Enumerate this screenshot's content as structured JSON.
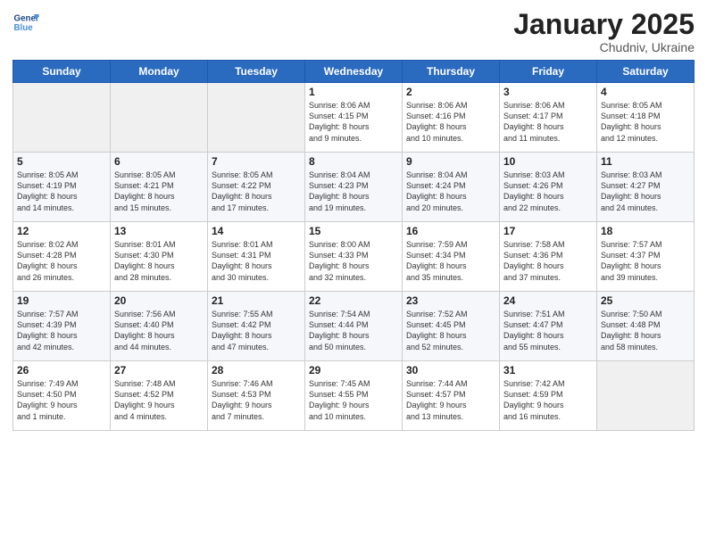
{
  "header": {
    "logo_line1": "General",
    "logo_line2": "Blue",
    "month": "January 2025",
    "location": "Chudniv, Ukraine"
  },
  "weekdays": [
    "Sunday",
    "Monday",
    "Tuesday",
    "Wednesday",
    "Thursday",
    "Friday",
    "Saturday"
  ],
  "weeks": [
    [
      {
        "day": "",
        "info": ""
      },
      {
        "day": "",
        "info": ""
      },
      {
        "day": "",
        "info": ""
      },
      {
        "day": "1",
        "info": "Sunrise: 8:06 AM\nSunset: 4:15 PM\nDaylight: 8 hours\nand 9 minutes."
      },
      {
        "day": "2",
        "info": "Sunrise: 8:06 AM\nSunset: 4:16 PM\nDaylight: 8 hours\nand 10 minutes."
      },
      {
        "day": "3",
        "info": "Sunrise: 8:06 AM\nSunset: 4:17 PM\nDaylight: 8 hours\nand 11 minutes."
      },
      {
        "day": "4",
        "info": "Sunrise: 8:05 AM\nSunset: 4:18 PM\nDaylight: 8 hours\nand 12 minutes."
      }
    ],
    [
      {
        "day": "5",
        "info": "Sunrise: 8:05 AM\nSunset: 4:19 PM\nDaylight: 8 hours\nand 14 minutes."
      },
      {
        "day": "6",
        "info": "Sunrise: 8:05 AM\nSunset: 4:21 PM\nDaylight: 8 hours\nand 15 minutes."
      },
      {
        "day": "7",
        "info": "Sunrise: 8:05 AM\nSunset: 4:22 PM\nDaylight: 8 hours\nand 17 minutes."
      },
      {
        "day": "8",
        "info": "Sunrise: 8:04 AM\nSunset: 4:23 PM\nDaylight: 8 hours\nand 19 minutes."
      },
      {
        "day": "9",
        "info": "Sunrise: 8:04 AM\nSunset: 4:24 PM\nDaylight: 8 hours\nand 20 minutes."
      },
      {
        "day": "10",
        "info": "Sunrise: 8:03 AM\nSunset: 4:26 PM\nDaylight: 8 hours\nand 22 minutes."
      },
      {
        "day": "11",
        "info": "Sunrise: 8:03 AM\nSunset: 4:27 PM\nDaylight: 8 hours\nand 24 minutes."
      }
    ],
    [
      {
        "day": "12",
        "info": "Sunrise: 8:02 AM\nSunset: 4:28 PM\nDaylight: 8 hours\nand 26 minutes."
      },
      {
        "day": "13",
        "info": "Sunrise: 8:01 AM\nSunset: 4:30 PM\nDaylight: 8 hours\nand 28 minutes."
      },
      {
        "day": "14",
        "info": "Sunrise: 8:01 AM\nSunset: 4:31 PM\nDaylight: 8 hours\nand 30 minutes."
      },
      {
        "day": "15",
        "info": "Sunrise: 8:00 AM\nSunset: 4:33 PM\nDaylight: 8 hours\nand 32 minutes."
      },
      {
        "day": "16",
        "info": "Sunrise: 7:59 AM\nSunset: 4:34 PM\nDaylight: 8 hours\nand 35 minutes."
      },
      {
        "day": "17",
        "info": "Sunrise: 7:58 AM\nSunset: 4:36 PM\nDaylight: 8 hours\nand 37 minutes."
      },
      {
        "day": "18",
        "info": "Sunrise: 7:57 AM\nSunset: 4:37 PM\nDaylight: 8 hours\nand 39 minutes."
      }
    ],
    [
      {
        "day": "19",
        "info": "Sunrise: 7:57 AM\nSunset: 4:39 PM\nDaylight: 8 hours\nand 42 minutes."
      },
      {
        "day": "20",
        "info": "Sunrise: 7:56 AM\nSunset: 4:40 PM\nDaylight: 8 hours\nand 44 minutes."
      },
      {
        "day": "21",
        "info": "Sunrise: 7:55 AM\nSunset: 4:42 PM\nDaylight: 8 hours\nand 47 minutes."
      },
      {
        "day": "22",
        "info": "Sunrise: 7:54 AM\nSunset: 4:44 PM\nDaylight: 8 hours\nand 50 minutes."
      },
      {
        "day": "23",
        "info": "Sunrise: 7:52 AM\nSunset: 4:45 PM\nDaylight: 8 hours\nand 52 minutes."
      },
      {
        "day": "24",
        "info": "Sunrise: 7:51 AM\nSunset: 4:47 PM\nDaylight: 8 hours\nand 55 minutes."
      },
      {
        "day": "25",
        "info": "Sunrise: 7:50 AM\nSunset: 4:48 PM\nDaylight: 8 hours\nand 58 minutes."
      }
    ],
    [
      {
        "day": "26",
        "info": "Sunrise: 7:49 AM\nSunset: 4:50 PM\nDaylight: 9 hours\nand 1 minute."
      },
      {
        "day": "27",
        "info": "Sunrise: 7:48 AM\nSunset: 4:52 PM\nDaylight: 9 hours\nand 4 minutes."
      },
      {
        "day": "28",
        "info": "Sunrise: 7:46 AM\nSunset: 4:53 PM\nDaylight: 9 hours\nand 7 minutes."
      },
      {
        "day": "29",
        "info": "Sunrise: 7:45 AM\nSunset: 4:55 PM\nDaylight: 9 hours\nand 10 minutes."
      },
      {
        "day": "30",
        "info": "Sunrise: 7:44 AM\nSunset: 4:57 PM\nDaylight: 9 hours\nand 13 minutes."
      },
      {
        "day": "31",
        "info": "Sunrise: 7:42 AM\nSunset: 4:59 PM\nDaylight: 9 hours\nand 16 minutes."
      },
      {
        "day": "",
        "info": ""
      }
    ]
  ]
}
